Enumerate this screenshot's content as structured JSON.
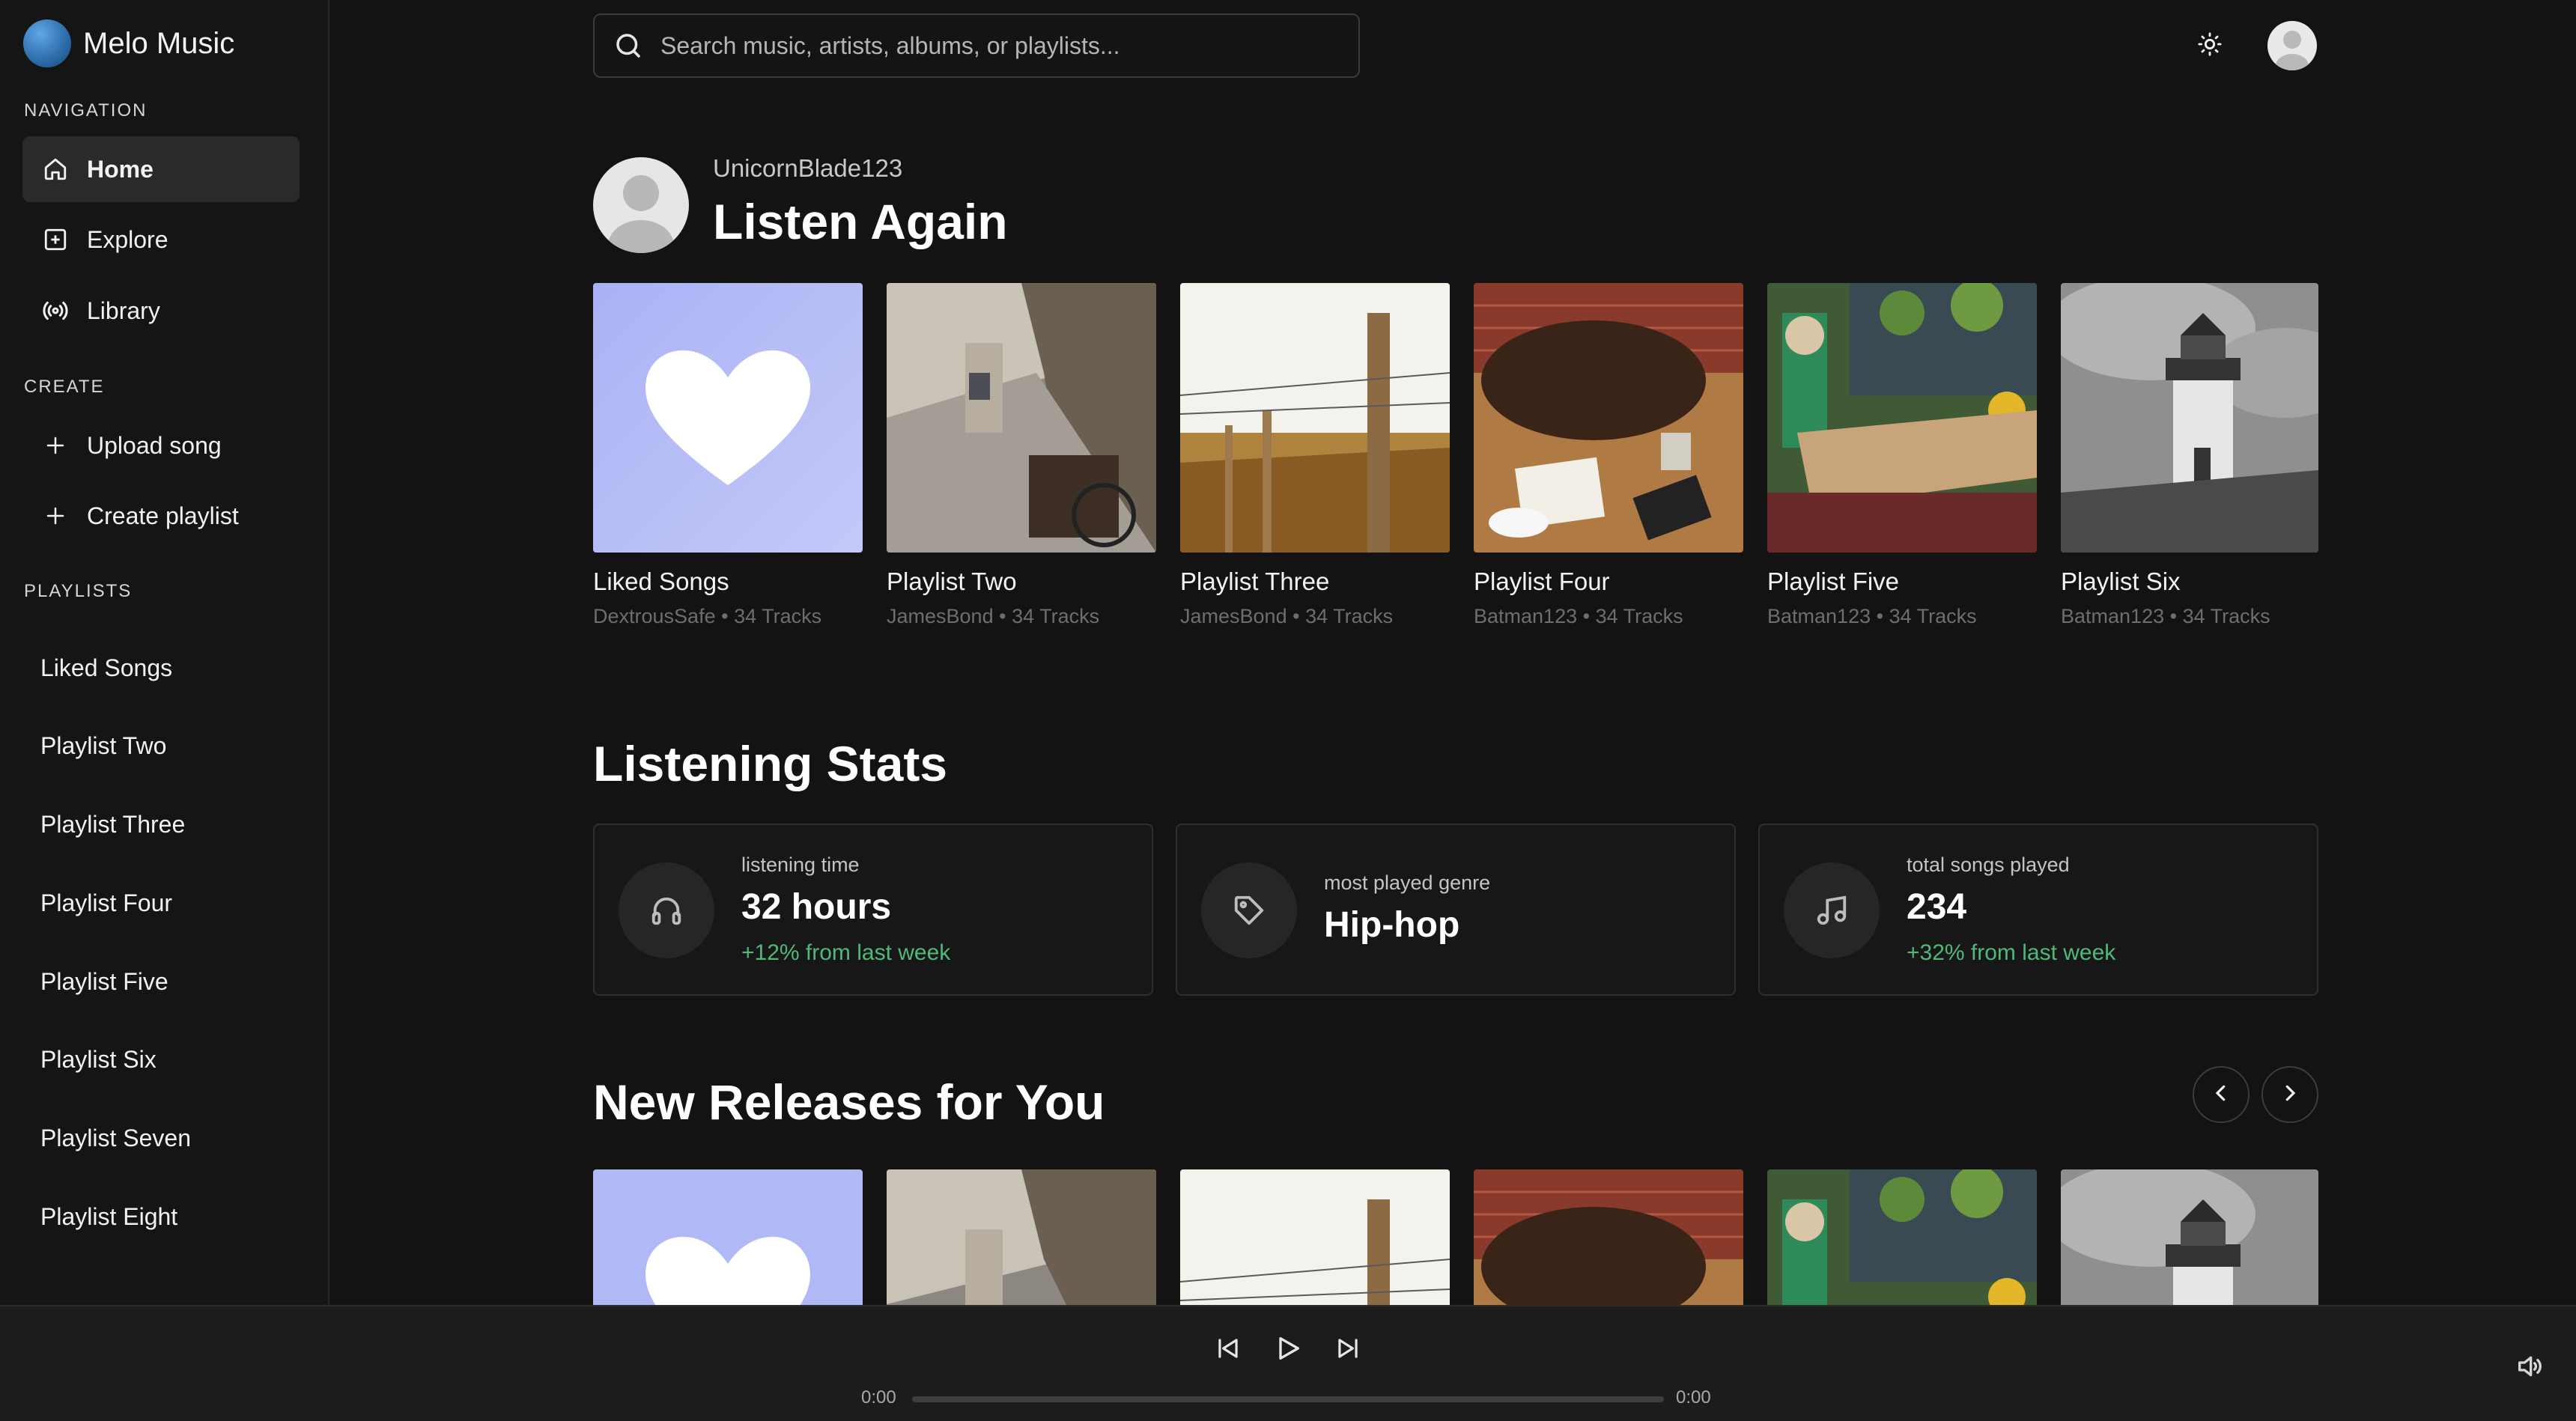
{
  "app": {
    "name": "Melo Music"
  },
  "sidebar": {
    "navigation_title": "NAVIGATION",
    "nav_items": [
      {
        "label": "Home",
        "icon": "home-icon",
        "active": true
      },
      {
        "label": "Explore",
        "icon": "plus-square-icon",
        "active": false
      },
      {
        "label": "Library",
        "icon": "broadcast-icon",
        "active": false
      }
    ],
    "create_title": "CREATE",
    "create_items": [
      {
        "label": "Upload song",
        "icon": "plus-icon"
      },
      {
        "label": "Create playlist",
        "icon": "plus-icon"
      }
    ],
    "playlists_title": "PLAYLISTS",
    "playlists": [
      "Liked Songs",
      "Playlist Two",
      "Playlist Three",
      "Playlist Four",
      "Playlist Five",
      "Playlist Six",
      "Playlist Seven",
      "Playlist Eight"
    ]
  },
  "search": {
    "placeholder": "Search music, artists, albums, or playlists..."
  },
  "header": {
    "username": "UnicornBlade123",
    "title": "Listen Again"
  },
  "listen_again": [
    {
      "title": "Liked Songs",
      "owner": "DextrousSafe",
      "tracks": "34 Tracks",
      "cover": "liked"
    },
    {
      "title": "Playlist Two",
      "owner": "JamesBond",
      "tracks": "34 Tracks",
      "cover": "street"
    },
    {
      "title": "Playlist Three",
      "owner": "JamesBond",
      "tracks": "34 Tracks",
      "cover": "fence"
    },
    {
      "title": "Playlist Four",
      "owner": "Batman123",
      "tracks": "34 Tracks",
      "cover": "desk"
    },
    {
      "title": "Playlist Five",
      "owner": "Batman123",
      "tracks": "34 Tracks",
      "cover": "cafe"
    },
    {
      "title": "Playlist Six",
      "owner": "Batman123",
      "tracks": "34 Tracks",
      "cover": "lighthouse"
    }
  ],
  "stats": {
    "title": "Listening Stats",
    "items": [
      {
        "label": "listening time",
        "value": "32 hours",
        "trend": "+12% from last week",
        "icon": "headphones-icon"
      },
      {
        "label": "most played genre",
        "value": "Hip-hop",
        "trend": "",
        "icon": "tag-icon"
      },
      {
        "label": "total songs played",
        "value": "234",
        "trend": "+32% from last week",
        "icon": "music-note-icon"
      }
    ]
  },
  "new_releases": {
    "title": "New Releases for You"
  },
  "player": {
    "current_time": "0:00",
    "duration": "0:00",
    "progress": 0
  },
  "colors": {
    "accent_green": "#4fb978",
    "liked_cover": "#b4bcf6",
    "background": "#131313"
  }
}
